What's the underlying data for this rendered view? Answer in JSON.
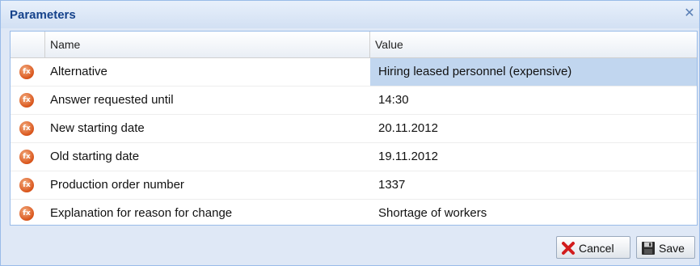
{
  "dialog": {
    "title": "Parameters",
    "close_icon": "close-icon"
  },
  "grid": {
    "columns": {
      "name": "Name",
      "value": "Value"
    },
    "rows": [
      {
        "name": "Alternative",
        "value": "Hiring leased personnel (expensive)",
        "selected": true
      },
      {
        "name": "Answer requested until",
        "value": "14:30"
      },
      {
        "name": "New starting date",
        "value": "20.11.2012"
      },
      {
        "name": "Old starting date",
        "value": "19.11.2012"
      },
      {
        "name": "Production order number",
        "value": "1337"
      },
      {
        "name": "Explanation for reason for change",
        "value": "Shortage of workers"
      }
    ],
    "row_icon": "parameter-icon"
  },
  "buttons": {
    "cancel": {
      "label": "Cancel",
      "icon": "red-x-icon"
    },
    "save": {
      "label": "Save",
      "icon": "floppy-disk-icon"
    }
  },
  "colors": {
    "title": "#15428b",
    "panel": "#dfe8f6",
    "border": "#99bbe8",
    "selected_cell": "#c1d6ef",
    "row_icon": "#d9541a"
  }
}
